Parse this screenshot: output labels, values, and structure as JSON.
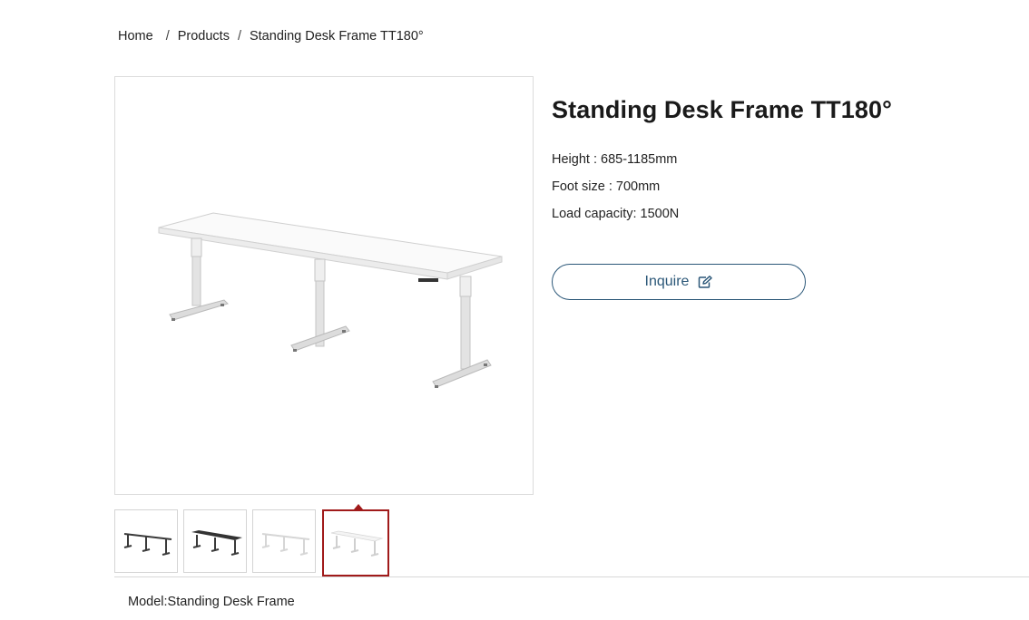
{
  "breadcrumb": {
    "items": [
      "Home",
      "Products",
      "Standing Desk Frame TT180°"
    ],
    "separator": "/"
  },
  "product": {
    "title": "Standing Desk Frame TT180°",
    "specs": [
      "Height : 685-1185mm",
      "Foot size : 700mm",
      "Load capacity: 1500N"
    ],
    "inquire_label": "Inquire",
    "model_line": "Model:Standing Desk Frame"
  },
  "gallery": {
    "thumbnails": [
      {
        "name": "black-frame",
        "frame_color": "#3a3a3a",
        "top": "none"
      },
      {
        "name": "black-desk",
        "frame_color": "#3a3a3a",
        "top": "#333333"
      },
      {
        "name": "white-frame",
        "frame_color": "#d6d6d6",
        "top": "none"
      },
      {
        "name": "white-desk",
        "frame_color": "#cfcfcf",
        "top": "#f4f4f4"
      }
    ],
    "active_index": 3
  },
  "colors": {
    "accent_button": "#2b5778",
    "active_thumb_border": "#a01a1a"
  },
  "icons": {
    "inquire": "edit-icon"
  }
}
